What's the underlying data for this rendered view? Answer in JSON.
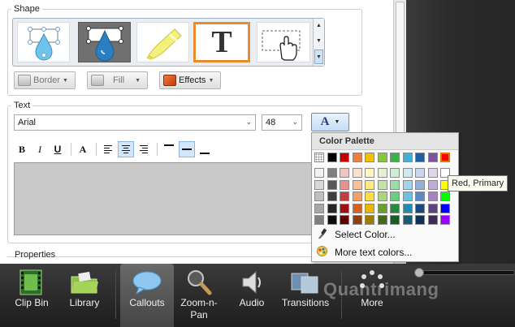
{
  "shape_panel": {
    "label": "Shape",
    "tiles": [
      "ellipse-callout-shape",
      "teardrop-callout-shape",
      "highlighter-shape",
      "text-shape",
      "click-area-shape"
    ],
    "selected_tile": "text-shape",
    "text_tile_glyph": "T",
    "border_label": "Border",
    "fill_label": "Fill",
    "effects_label": "Effects"
  },
  "text_panel": {
    "label": "Text",
    "font": "Arial",
    "size": "48",
    "color_button_glyph": "A",
    "format_buttons": [
      "B",
      "I",
      "U",
      "A"
    ],
    "active_alignment": "center",
    "active_vertical": "middle"
  },
  "properties_label": "Properties",
  "palette": {
    "title": "Color Palette",
    "primary_row": [
      "#ffffff",
      "#000000",
      "#c00000",
      "#f07f3c",
      "#f5c000",
      "#85c83c",
      "#37b34a",
      "#3fb0d6",
      "#1f5fa5",
      "#7b55a2",
      "#ff0000"
    ],
    "columns": [
      [
        "#f2f2f2",
        "#d9d9d9",
        "#bfbfbf",
        "#a6a6a6",
        "#7f7f7f"
      ],
      [
        "#7f7f7f",
        "#595959",
        "#3f3f3f",
        "#262626",
        "#0c0c0c"
      ],
      [
        "#f2c5c5",
        "#e69090",
        "#c04040",
        "#a01010",
        "#600000"
      ],
      [
        "#fbe0cc",
        "#f7c199",
        "#f2a266",
        "#d46420",
        "#8f3f10"
      ],
      [
        "#fff4c2",
        "#ffe985",
        "#ffdd47",
        "#e8b800",
        "#9e7e00"
      ],
      [
        "#e2f1d3",
        "#c6e3a7",
        "#a9d57b",
        "#67a02a",
        "#44691c"
      ],
      [
        "#cdeed5",
        "#9bdeab",
        "#69ce82",
        "#268a3a",
        "#185c26"
      ],
      [
        "#cfe9f4",
        "#9fd4ea",
        "#6fbfe0",
        "#2389b0",
        "#175b76"
      ],
      [
        "#c8d8ec",
        "#91b1d9",
        "#5a89c6",
        "#174a82",
        "#0f3157"
      ],
      [
        "#e0d6ea",
        "#c1add5",
        "#a384c0",
        "#5f4280",
        "#3f2c55"
      ],
      [
        "#ffffff",
        "#ffff00",
        "#00ff00",
        "#0000ff",
        "#9900ff"
      ]
    ],
    "select_color_label": "Select Color...",
    "more_colors_label": "More text colors..."
  },
  "tooltip": "Red, Primary",
  "bottom_bar": {
    "items": [
      {
        "id": "clip-bin",
        "label": "Clip Bin"
      },
      {
        "id": "library",
        "label": "Library"
      },
      {
        "id": "callouts",
        "label": "Callouts"
      },
      {
        "id": "zoom-n-pan",
        "label": "Zoom-n-\nPan"
      },
      {
        "id": "audio",
        "label": "Audio"
      },
      {
        "id": "transitions",
        "label": "Transitions"
      },
      {
        "id": "more",
        "label": "More"
      }
    ],
    "active": "callouts"
  },
  "watermark": "Quantrimang"
}
